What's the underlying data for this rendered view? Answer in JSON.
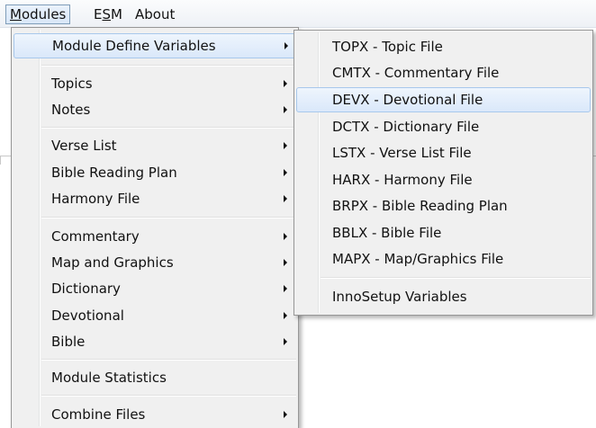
{
  "menubar": {
    "modules": "Modules",
    "esm": "ESM",
    "about": "About"
  },
  "main_menu": {
    "items": [
      {
        "label": "Module Define Variables",
        "submenu": true
      },
      {
        "label": "Topics",
        "submenu": true
      },
      {
        "label": "Notes",
        "submenu": true
      },
      {
        "label": "Verse List",
        "submenu": true
      },
      {
        "label": "Bible Reading Plan",
        "submenu": true
      },
      {
        "label": "Harmony File",
        "submenu": true
      },
      {
        "label": "Commentary",
        "submenu": true
      },
      {
        "label": "Map and Graphics",
        "submenu": true
      },
      {
        "label": "Dictionary",
        "submenu": true
      },
      {
        "label": "Devotional",
        "submenu": true
      },
      {
        "label": "Bible",
        "submenu": true
      },
      {
        "label": "Module Statistics",
        "submenu": false
      },
      {
        "label": "Combine Files",
        "submenu": true
      }
    ]
  },
  "sub_menu": {
    "items": [
      {
        "label": "TOPX - Topic File"
      },
      {
        "label": "CMTX - Commentary File"
      },
      {
        "label": "DEVX - Devotional File",
        "highlighted": true
      },
      {
        "label": "DCTX - Dictionary File"
      },
      {
        "label": "LSTX - Verse List File"
      },
      {
        "label": "HARX - Harmony File"
      },
      {
        "label": "BRPX - Bible Reading Plan"
      },
      {
        "label": "BBLX - Bible File"
      },
      {
        "label": "MAPX - Map/Graphics File"
      },
      {
        "label": "InnoSetup Variables"
      }
    ]
  }
}
